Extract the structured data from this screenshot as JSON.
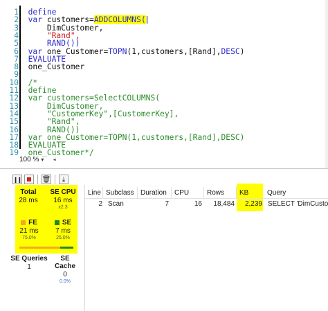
{
  "editor": {
    "lines": [
      {
        "n": "1",
        "parts": [
          {
            "t": "define",
            "c": "kw"
          }
        ]
      },
      {
        "n": "2",
        "parts": [
          {
            "t": "var ",
            "c": "kw"
          },
          {
            "t": "customers=",
            "c": "tx"
          },
          {
            "t": "ADDCOLUMNS(",
            "c": "fn hl"
          }
        ]
      },
      {
        "n": "3",
        "parts": [
          {
            "t": "    DimCustomer,",
            "c": "tx"
          }
        ]
      },
      {
        "n": "4",
        "parts": [
          {
            "t": "    \"Rand\",",
            "c": "str"
          }
        ]
      },
      {
        "n": "5",
        "parts": [
          {
            "t": "    RAND())",
            "c": "fn"
          }
        ]
      },
      {
        "n": "6",
        "parts": [
          {
            "t": "var ",
            "c": "kw"
          },
          {
            "t": "one_Customer=",
            "c": "tx"
          },
          {
            "t": "TOPN",
            "c": "fn"
          },
          {
            "t": "(1,customers,[Rand],",
            "c": "tx"
          },
          {
            "t": "DESC",
            "c": "kw"
          },
          {
            "t": ")",
            "c": "tx"
          }
        ]
      },
      {
        "n": "7",
        "parts": [
          {
            "t": "EVALUATE",
            "c": "kw"
          }
        ]
      },
      {
        "n": "8",
        "parts": [
          {
            "t": "one_Customer",
            "c": "tx"
          }
        ]
      },
      {
        "n": "9",
        "parts": []
      },
      {
        "n": "10",
        "parts": [
          {
            "t": "/*",
            "c": "cm"
          }
        ]
      },
      {
        "n": "11",
        "parts": [
          {
            "t": "define",
            "c": "cm"
          }
        ]
      },
      {
        "n": "12",
        "parts": [
          {
            "t": "var customers=SelectCOLUMNS(",
            "c": "cm"
          }
        ]
      },
      {
        "n": "13",
        "parts": [
          {
            "t": "    DimCustomer,",
            "c": "cm"
          }
        ]
      },
      {
        "n": "14",
        "parts": [
          {
            "t": "    \"CustomerKey\",[CustomerKey],",
            "c": "cm"
          }
        ]
      },
      {
        "n": "15",
        "parts": [
          {
            "t": "    \"Rand\",",
            "c": "cm"
          }
        ]
      },
      {
        "n": "16",
        "parts": [
          {
            "t": "    RAND())",
            "c": "cm"
          }
        ]
      },
      {
        "n": "17",
        "parts": [
          {
            "t": "var one_Customer=TOPN(1,customers,[Rand],DESC)",
            "c": "cm"
          }
        ]
      },
      {
        "n": "18",
        "parts": [
          {
            "t": "EVALUATE",
            "c": "cm"
          }
        ]
      },
      {
        "n": "19",
        "parts": [
          {
            "t": "one_Customer*/",
            "c": "cm"
          }
        ]
      }
    ],
    "zoom": "100 %"
  },
  "toolbar": {
    "buttons": [
      "pause",
      "stop",
      "clear",
      "export"
    ]
  },
  "stats": {
    "total": {
      "label": "Total",
      "value": "28 ms"
    },
    "se_cpu": {
      "label": "SE CPU",
      "value": "16 ms",
      "sub": "x2.3"
    },
    "fe": {
      "label": "FE",
      "value": "21 ms",
      "sub": "75.0%"
    },
    "se": {
      "label": "SE",
      "value": "7 ms",
      "sub": "25.0%"
    },
    "se_queries": {
      "label": "SE Queries",
      "value": "1"
    },
    "se_cache": {
      "label": "SE Cache",
      "value": "0",
      "sub": "0.0%"
    },
    "fe_fraction": 0.75,
    "colors": {
      "fe": "#f7a823",
      "se": "#1e8a1e",
      "highlight": "#ffff00"
    }
  },
  "grid": {
    "columns": [
      "Line",
      "Subclass",
      "Duration",
      "CPU",
      "Rows",
      "KB",
      "Query"
    ],
    "rows": [
      {
        "line": "2",
        "subclass": "Scan",
        "duration": "7",
        "cpu": "16",
        "rows": "18,484",
        "kb": "2,239",
        "query": "SELECT 'DimCustom"
      }
    ]
  }
}
